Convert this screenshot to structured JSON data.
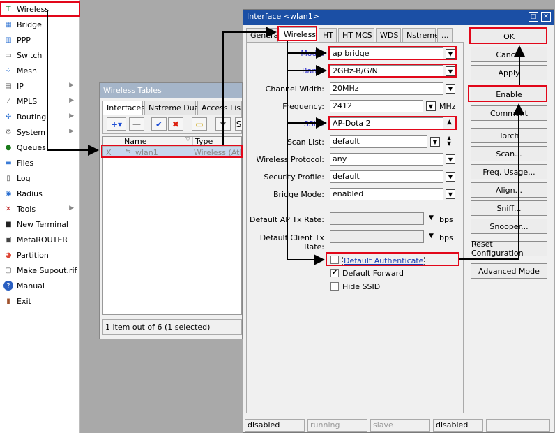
{
  "menu": {
    "items": [
      {
        "label": "Wireless",
        "icon": "wifi-icon",
        "arrow": false
      },
      {
        "label": "Bridge",
        "icon": "bridge-icon",
        "arrow": false
      },
      {
        "label": "PPP",
        "icon": "ppp-icon",
        "arrow": false
      },
      {
        "label": "Switch",
        "icon": "switch-icon",
        "arrow": false
      },
      {
        "label": "Mesh",
        "icon": "mesh-icon",
        "arrow": false
      },
      {
        "label": "IP",
        "icon": "ip-icon",
        "arrow": true
      },
      {
        "label": "MPLS",
        "icon": "mpls-icon",
        "arrow": true
      },
      {
        "label": "Routing",
        "icon": "routing-icon",
        "arrow": true
      },
      {
        "label": "System",
        "icon": "gear-icon",
        "arrow": true
      },
      {
        "label": "Queues",
        "icon": "queues-icon",
        "arrow": false
      },
      {
        "label": "Files",
        "icon": "folder-icon",
        "arrow": false
      },
      {
        "label": "Log",
        "icon": "log-icon",
        "arrow": false
      },
      {
        "label": "Radius",
        "icon": "radius-icon",
        "arrow": false
      },
      {
        "label": "Tools",
        "icon": "tools-icon",
        "arrow": true
      },
      {
        "label": "New Terminal",
        "icon": "terminal-icon",
        "arrow": false
      },
      {
        "label": "MetaROUTER",
        "icon": "metarouter-icon",
        "arrow": false
      },
      {
        "label": "Partition",
        "icon": "partition-icon",
        "arrow": false
      },
      {
        "label": "Make Supout.rif",
        "icon": "supout-icon",
        "arrow": false
      },
      {
        "label": "Manual",
        "icon": "help-icon",
        "arrow": false
      },
      {
        "label": "Exit",
        "icon": "exit-icon",
        "arrow": false
      }
    ]
  },
  "wireless_tables": {
    "title": "Wireless Tables",
    "tabs": [
      "Interfaces",
      "Nstreme Dual",
      "Access List"
    ],
    "columns": [
      "Name",
      "Type"
    ],
    "row": {
      "flag": "X",
      "name": "wlan1",
      "type": "Wireless (Athe"
    },
    "status": "1 item out of 6 (1 selected)"
  },
  "dialog": {
    "title": "Interface <wlan1>",
    "tabs": [
      "General",
      "Wireless",
      "HT",
      "HT MCS",
      "WDS",
      "Nstreme",
      "..."
    ],
    "fields": {
      "mode": {
        "label": "Mode:",
        "value": "ap bridge"
      },
      "band": {
        "label": "Band:",
        "value": "2GHz-B/G/N"
      },
      "channel_width": {
        "label": "Channel Width:",
        "value": "20MHz"
      },
      "frequency": {
        "label": "Frequency:",
        "value": "2412",
        "unit": "MHz"
      },
      "ssid": {
        "label": "SSID:",
        "value": "AP-Dota 2"
      },
      "scan_list": {
        "label": "Scan List:",
        "value": "default"
      },
      "wireless_protocol": {
        "label": "Wireless Protocol:",
        "value": "any"
      },
      "security_profile": {
        "label": "Security Profile:",
        "value": "default"
      },
      "bridge_mode": {
        "label": "Bridge Mode:",
        "value": "enabled"
      },
      "default_ap_tx_rate": {
        "label": "Default AP Tx Rate:",
        "value": "",
        "unit": "bps"
      },
      "default_client_tx_rate": {
        "label": "Default Client Tx Rate:",
        "value": "",
        "unit": "bps"
      }
    },
    "checkboxes": [
      {
        "label": "Default Authenticate",
        "checked": false
      },
      {
        "label": "Default Forward",
        "checked": true
      },
      {
        "label": "Hide SSID",
        "checked": false
      }
    ],
    "buttons": [
      "OK",
      "Cancel",
      "Apply",
      "Enable",
      "Comment",
      "Torch",
      "Scan...",
      "Freq. Usage...",
      "Align...",
      "Sniff...",
      "Snooper...",
      "Reset Configuration",
      "Advanced Mode"
    ],
    "status": [
      "disabled",
      "running",
      "slave",
      "disabled"
    ]
  },
  "colors": {
    "highlight": "#e2071a",
    "title_bar": "#1b4fa5",
    "link_blue": "#2d2dcc"
  }
}
